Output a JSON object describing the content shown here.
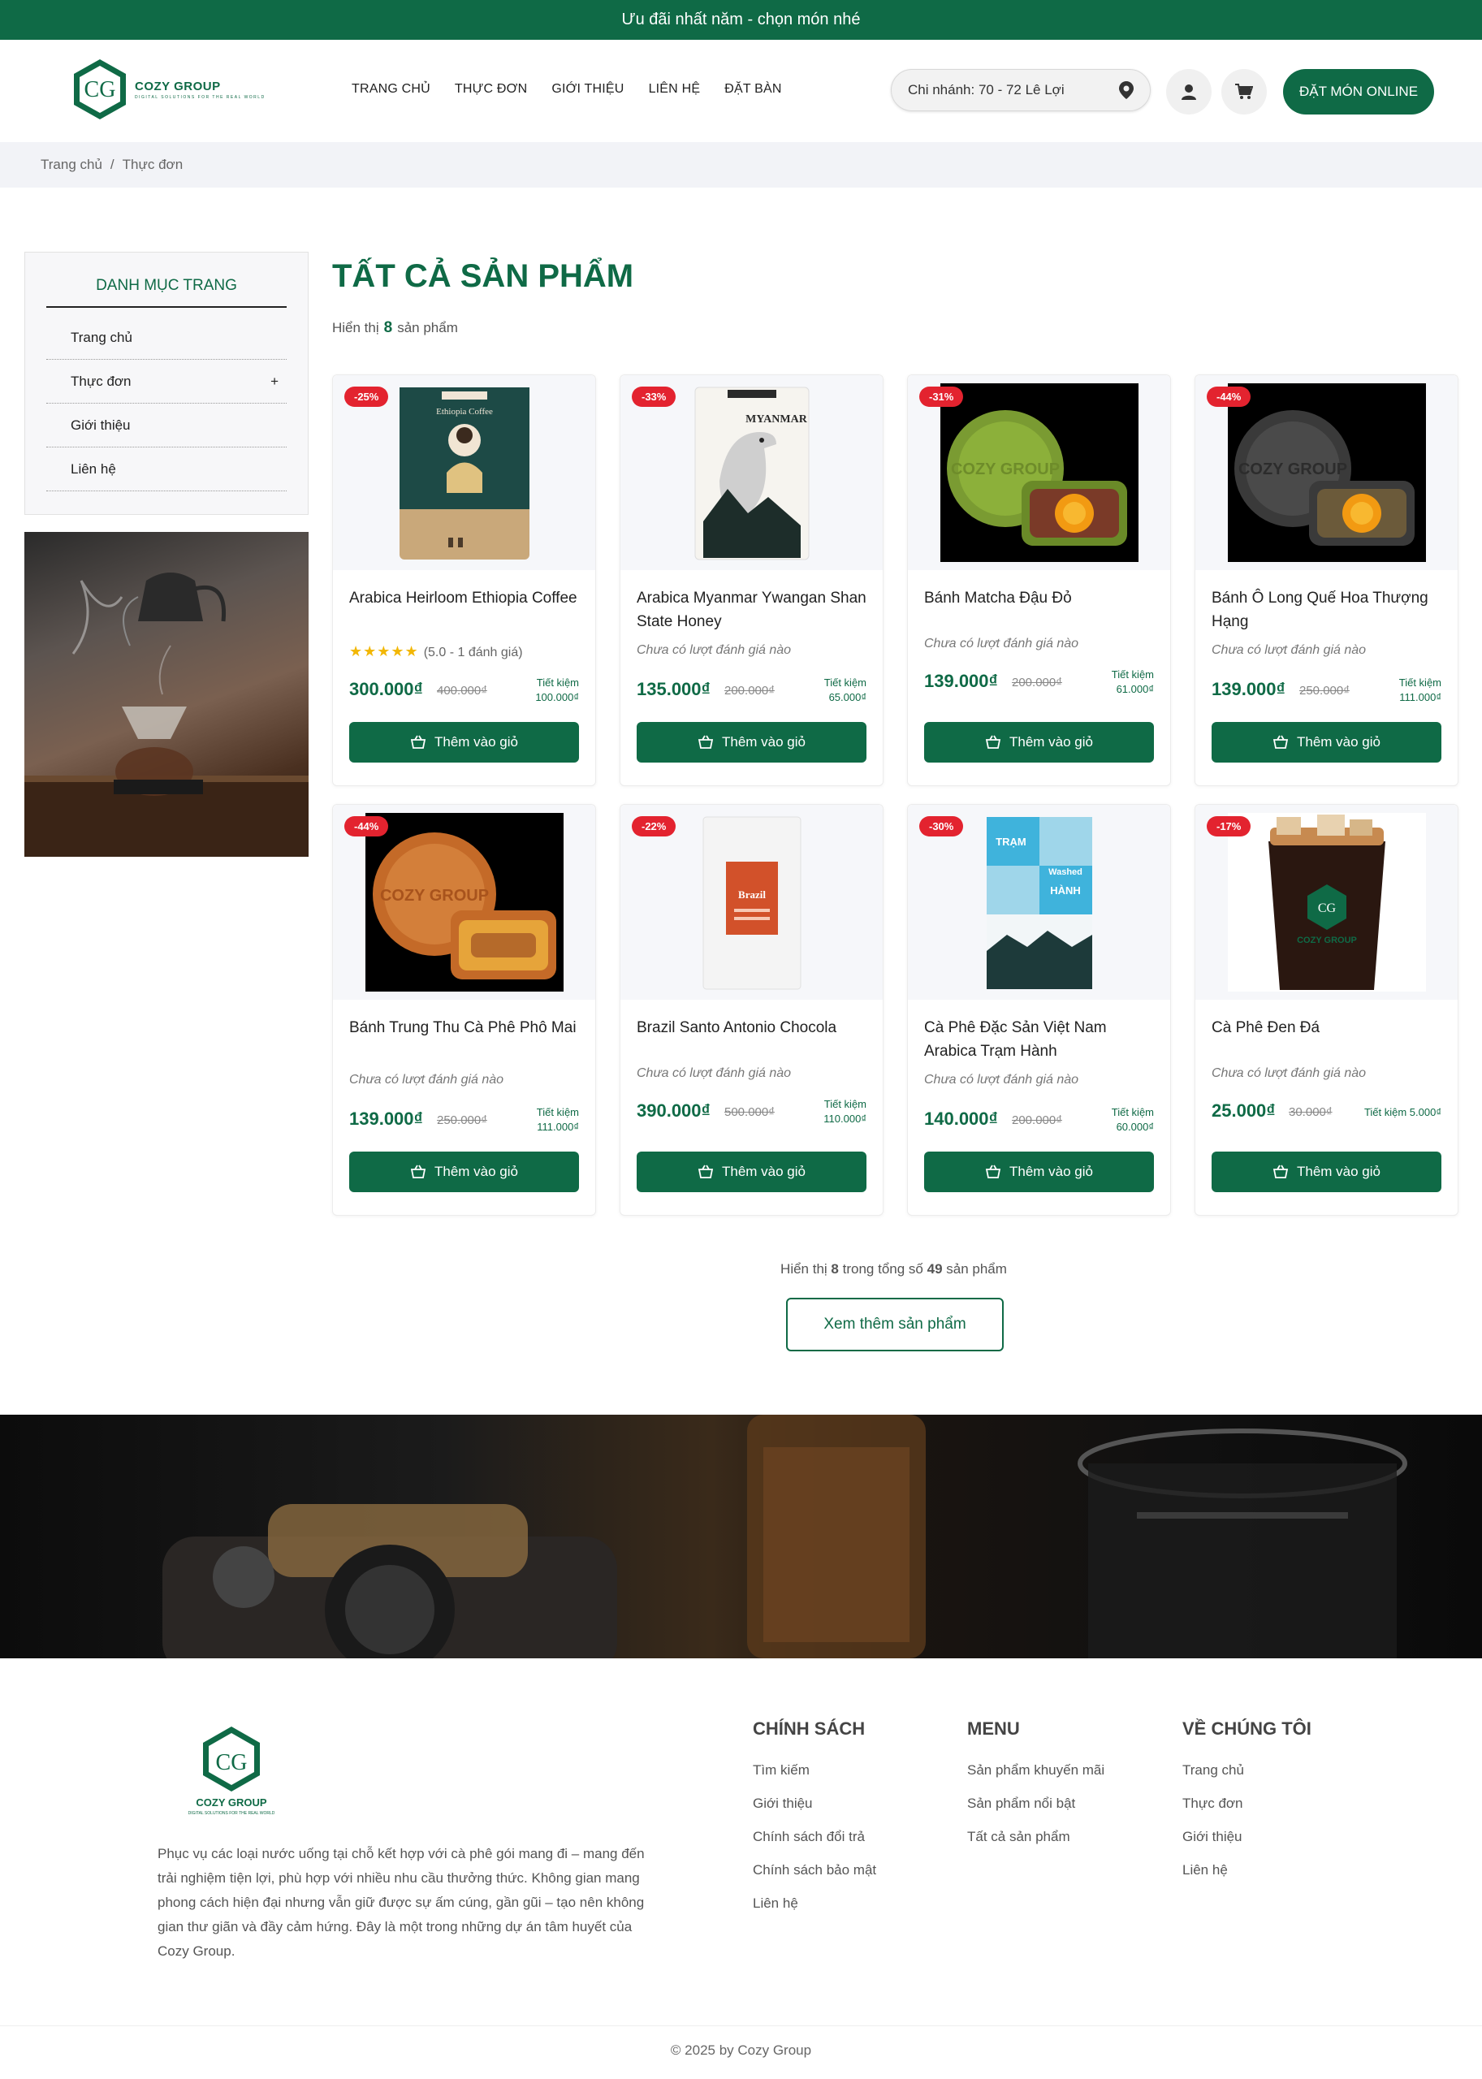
{
  "promo": "Ưu đãi nhất năm - chọn món nhé",
  "brand": {
    "name": "COZY GROUP",
    "tagline": "DIGITAL SOLUTIONS FOR THE REAL WORLD",
    "mark": "CG"
  },
  "nav": [
    "TRANG CHỦ",
    "THỰC ĐƠN",
    "GIỚI THIỆU",
    "LIÊN HỆ",
    "ĐẶT BÀN"
  ],
  "branch": "Chi nhánh: 70 - 72 Lê Lợi",
  "order_button": "ĐẶT MÓN ONLINE",
  "breadcrumb": {
    "home": "Trang chủ",
    "sep": "/",
    "current": "Thực đơn"
  },
  "sidebar": {
    "title": "DANH MỤC TRANG",
    "items": [
      "Trang chủ",
      "Thực đơn",
      "Giới thiệu",
      "Liên hệ"
    ],
    "expand": "+"
  },
  "main": {
    "title": "TẤT CẢ SẢN PHẨM",
    "shown_prefix": "Hiển thị",
    "shown_count": "8",
    "shown_suffix": "sản phẩm"
  },
  "add_label": "Thêm vào giỏ",
  "products": [
    {
      "badge": "-25%",
      "name": "Arabica Heirloom Ethiopia Coffee",
      "stars": "★★★★★",
      "rating": "(5.0 - 1 đánh giá)",
      "price": "300.000₫",
      "old": "400.000₫",
      "save1": "Tiết kiệm",
      "save2": "100.000₫"
    },
    {
      "badge": "-33%",
      "name": "Arabica Myanmar Ywangan Shan State Honey",
      "rating": "Chưa có lượt đánh giá nào",
      "price": "135.000₫",
      "old": "200.000₫",
      "save1": "Tiết kiệm",
      "save2": "65.000₫"
    },
    {
      "badge": "-31%",
      "name": "Bánh Matcha Đậu Đỏ",
      "rating": "Chưa có lượt đánh giá nào",
      "price": "139.000₫",
      "old": "200.000₫",
      "save1": "Tiết kiệm",
      "save2": "61.000₫"
    },
    {
      "badge": "-44%",
      "name": "Bánh Ô Long Quế Hoa Thượng Hạng",
      "rating": "Chưa có lượt đánh giá nào",
      "price": "139.000₫",
      "old": "250.000₫",
      "save1": "Tiết kiệm",
      "save2": "111.000₫"
    },
    {
      "badge": "-44%",
      "name": "Bánh Trung Thu Cà Phê Phô Mai",
      "rating": "Chưa có lượt đánh giá nào",
      "price": "139.000₫",
      "old": "250.000₫",
      "save1": "Tiết kiệm",
      "save2": "111.000₫"
    },
    {
      "badge": "-22%",
      "name": "Brazil Santo Antonio Chocola",
      "rating": "Chưa có lượt đánh giá nào",
      "price": "390.000₫",
      "old": "500.000₫",
      "save1": "Tiết kiệm",
      "save2": "110.000₫"
    },
    {
      "badge": "-30%",
      "name": "Cà Phê Đặc Sản Việt Nam Arabica Trạm Hành",
      "rating": "Chưa có lượt đánh giá nào",
      "price": "140.000₫",
      "old": "200.000₫",
      "save1": "Tiết kiệm",
      "save2": "60.000₫"
    },
    {
      "badge": "-17%",
      "name": "Cà Phê Đen Đá",
      "rating": "Chưa có lượt đánh giá nào",
      "price": "25.000₫",
      "old": "30.000₫",
      "save1": "Tiết kiệm 5.000₫",
      "save2": ""
    }
  ],
  "product_images": {
    "p1_label": "Ethiopia Coffee",
    "p2_label": "MYANMAR",
    "p3_label": "COZY GROUP",
    "p4_label": "COZY GROUP",
    "p5_label": "COZY GROUP",
    "p6_label": "Brazil",
    "p7_top": "TRẠM",
    "p7_mid": "Washed",
    "p7_low": "HÀNH",
    "p8_label": "COZY GROUP"
  },
  "pagination": {
    "prefix": "Hiển thị",
    "shown": "8",
    "middle": "trong tổng số",
    "total": "49",
    "suffix": "sản phẩm",
    "more": "Xem thêm sản phẩm"
  },
  "footer": {
    "description": "Phục vụ các loại nước uống tại chỗ kết hợp với cà phê gói mang đi – mang đến trải nghiệm tiện lợi, phù hợp với nhiều nhu cầu thưởng thức. Không gian mang phong cách hiện đại nhưng vẫn giữ được sự ấm cúng, gần gũi – tạo nên không gian thư giãn và đầy cảm hứng. Đây là một trong những dự án tâm huyết của Cozy Group.",
    "policy": {
      "title": "CHÍNH SÁCH",
      "links": [
        "Tìm kiếm",
        "Giới thiệu",
        "Chính sách đổi trả",
        "Chính sách bảo mật",
        "Liên hệ"
      ]
    },
    "menu": {
      "title": "MENU",
      "links": [
        "Sản phẩm khuyến mãi",
        "Sản phẩm nổi bật",
        "Tất cả sản phẩm"
      ]
    },
    "about": {
      "title": "VỀ CHÚNG TÔI",
      "links": [
        "Trang chủ",
        "Thực đơn",
        "Giới thiệu",
        "Liên hệ"
      ]
    },
    "copyright": "© 2025 by Cozy Group"
  },
  "colors": {
    "brand": "#0f6a46",
    "badge": "#e3232f",
    "star": "#f2b705"
  }
}
